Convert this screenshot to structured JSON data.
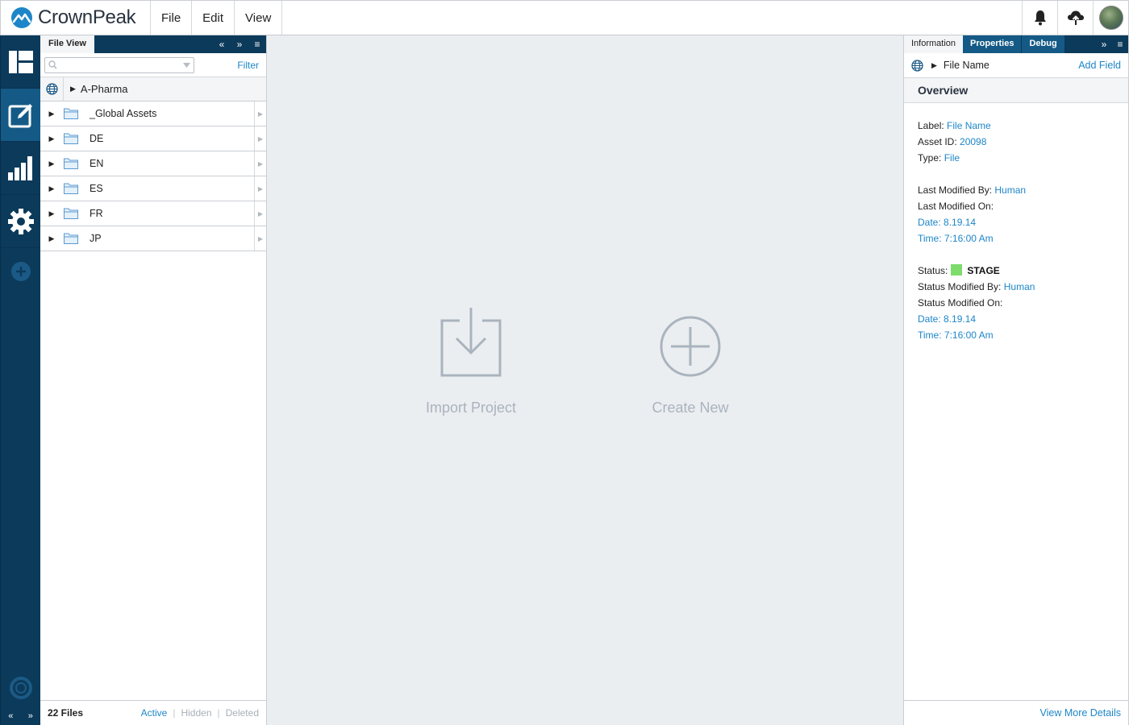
{
  "app": {
    "logo_text": "CrownPeak",
    "menu": [
      "File",
      "Edit",
      "View"
    ],
    "header_icons": [
      "bell-icon",
      "cloud-upload-icon",
      "user-avatar"
    ]
  },
  "leftnav": {
    "items": [
      "dashboard-icon",
      "edit-icon",
      "reports-icon",
      "settings-icon"
    ],
    "active_index": 1
  },
  "file_view": {
    "tab_label": "File View",
    "search": {
      "value": "",
      "placeholder": ""
    },
    "filter_label": "Filter",
    "root": "A-Pharma",
    "folders": [
      "_Global Assets",
      "DE",
      "EN",
      "ES",
      "FR",
      "JP"
    ],
    "footer": {
      "count": "22 Files",
      "active": "Active",
      "hidden": "Hidden",
      "deleted": "Deleted"
    }
  },
  "main": {
    "import_label": "Import Project",
    "create_label": "Create New"
  },
  "info": {
    "tabs": [
      "Information",
      "Properties",
      "Debug"
    ],
    "header_name": "File Name",
    "add_field": "Add Field",
    "overview": "Overview",
    "label_key": "Label:",
    "label_val": "File Name",
    "asset_key": "Asset ID:",
    "asset_val": "20098",
    "type_key": "Type:",
    "type_val": "File",
    "modified_by_key": "Last Modified By:",
    "modified_by_val": "Human",
    "modified_on_key": "Last Modified On:",
    "modified_date": "Date: 8.19.14",
    "modified_time": "Time: 7:16:00 Am",
    "status_key": "Status:",
    "status_val": "STAGE",
    "status_color": "#7ddc6b",
    "status_by_key": "Status Modified By:",
    "status_by_val": "Human",
    "status_on_key": "Status Modified On:",
    "status_date": "Date: 8.19.14",
    "status_time": "Time: 7:16:00 Am",
    "view_more": "View More Details"
  },
  "colors": {
    "nav_dark": "#0c3a5a",
    "nav_active": "#155a86",
    "link": "#1d86c8",
    "canvas": "#ebeef1"
  }
}
